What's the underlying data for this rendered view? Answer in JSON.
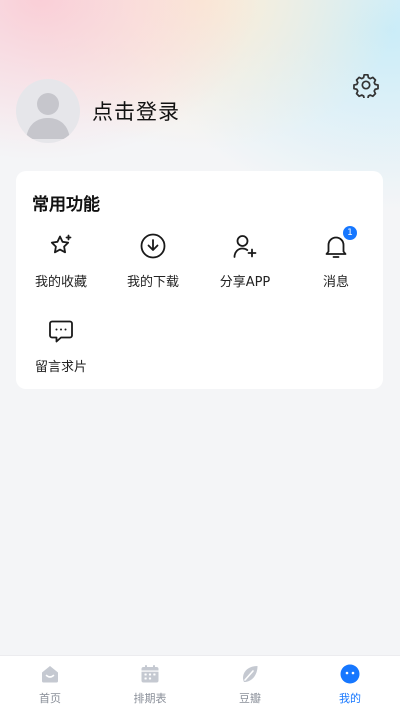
{
  "header": {
    "login_text": "点击登录"
  },
  "features": {
    "title": "常用功能",
    "items": [
      {
        "label": "我的收藏",
        "icon": "star-sparkle-icon"
      },
      {
        "label": "我的下载",
        "icon": "download-icon"
      },
      {
        "label": "分享APP",
        "icon": "share-user-icon"
      },
      {
        "label": "消息",
        "icon": "bell-icon",
        "badge": "1"
      },
      {
        "label": "留言求片",
        "icon": "message-bubble-icon"
      }
    ]
  },
  "tabbar": {
    "items": [
      {
        "label": "首页",
        "icon": "home-icon"
      },
      {
        "label": "排期表",
        "icon": "calendar-icon"
      },
      {
        "label": "豆瓣",
        "icon": "leaf-icon"
      },
      {
        "label": "我的",
        "icon": "profile-face-icon",
        "active": true
      }
    ]
  },
  "colors": {
    "accent": "#1677ff",
    "tab_inactive": "#8a8f99",
    "background": "#f4f5f7"
  }
}
